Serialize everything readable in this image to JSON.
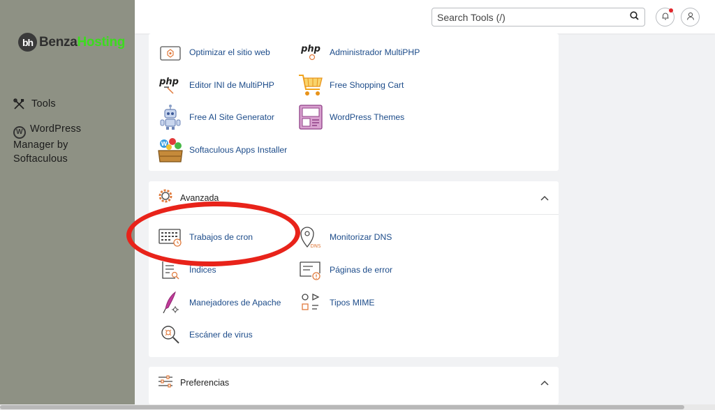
{
  "brand": {
    "badge": "bh",
    "name_part1": "Benza",
    "name_part2": "Hosting",
    "accent": "#3cdc1e"
  },
  "sidebar": {
    "items": [
      {
        "label": "Tools",
        "icon": "tools-icon"
      },
      {
        "label": "WordPress Manager by Softaculous",
        "icon": "wordpress-icon"
      }
    ]
  },
  "topbar": {
    "search_placeholder": "Search Tools (/)",
    "icons": [
      "search-icon",
      "bell-icon",
      "user-icon"
    ],
    "notification_color": "#e0262b"
  },
  "software_section": {
    "items": [
      {
        "label": "Optimizar el sitio web",
        "icon": "optimize-icon"
      },
      {
        "label": "Administrador MultiPHP",
        "icon": "php-icon"
      },
      {
        "label": "Editor INI de MultiPHP",
        "icon": "php-editor-icon"
      },
      {
        "label": "Free Shopping Cart",
        "icon": "shopping-cart-icon"
      },
      {
        "label": "Free AI Site Generator",
        "icon": "robot-icon"
      },
      {
        "label": "WordPress Themes",
        "icon": "wordpress-themes-icon"
      },
      {
        "label": "Softaculous Apps Installer",
        "icon": "softaculous-icon"
      }
    ]
  },
  "advanced_section": {
    "title": "Avanzada",
    "items": [
      {
        "label": "Trabajos de cron",
        "icon": "cron-calendar-icon"
      },
      {
        "label": "Monitorizar DNS",
        "icon": "dns-pin-icon",
        "badge": "DNS"
      },
      {
        "label": "Índices",
        "icon": "index-icon"
      },
      {
        "label": "Páginas de error",
        "icon": "error-pages-icon"
      },
      {
        "label": "Manejadores de Apache",
        "icon": "apache-feather-icon"
      },
      {
        "label": "Tipos MIME",
        "icon": "mime-types-icon"
      },
      {
        "label": "Escáner de virus",
        "icon": "virus-scanner-icon"
      }
    ]
  },
  "preferences_section": {
    "title": "Preferencias"
  },
  "annotation": {
    "color": "#e8231a",
    "target": "Trabajos de cron"
  }
}
